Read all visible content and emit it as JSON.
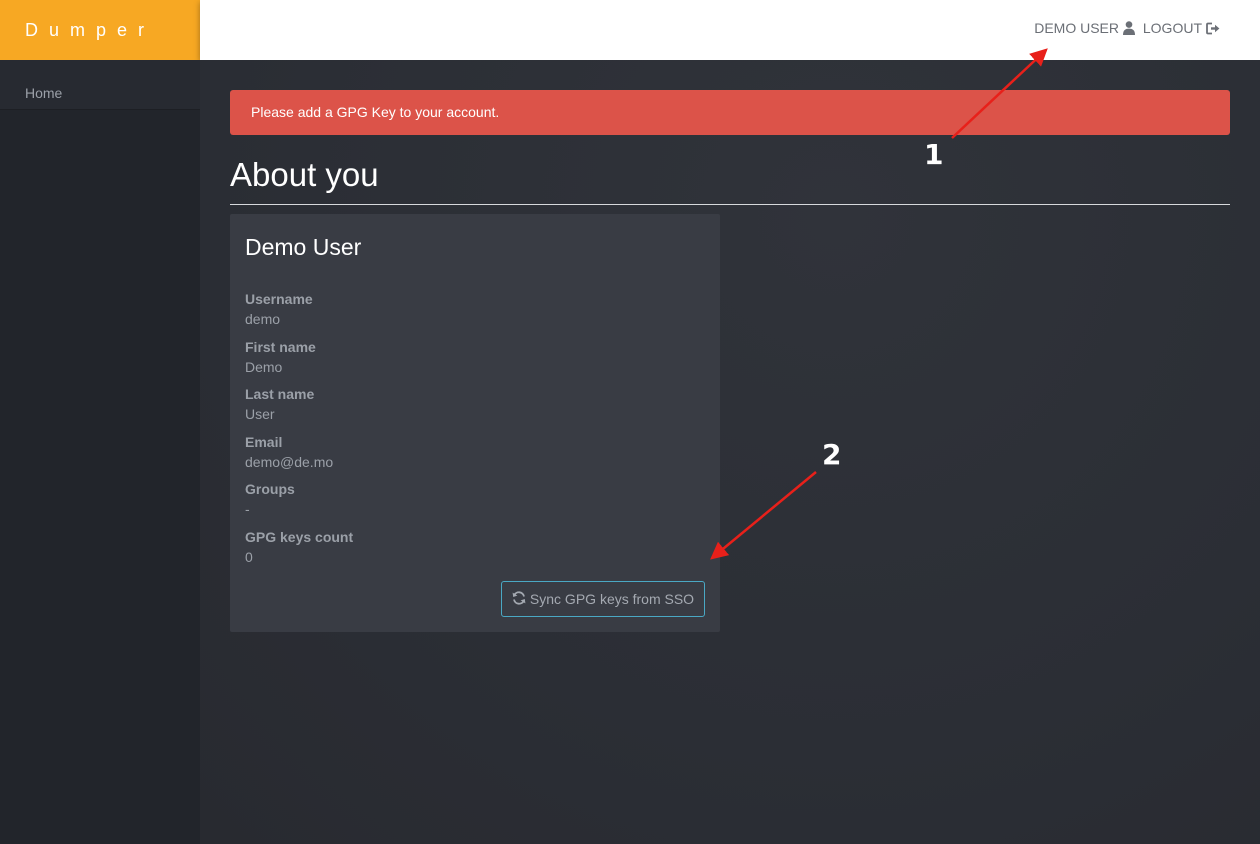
{
  "app": {
    "brand": "Dumper"
  },
  "topbar": {
    "user_label": "DEMO USER",
    "logout_label": "LOGOUT"
  },
  "sidebar": {
    "items": [
      {
        "label": "Home"
      }
    ]
  },
  "alert": {
    "message": "Please add a GPG Key to your account."
  },
  "page": {
    "title": "About you"
  },
  "profile": {
    "name": "Demo User",
    "fields": [
      {
        "label": "Username",
        "value": "demo"
      },
      {
        "label": "First name",
        "value": "Demo"
      },
      {
        "label": "Last name",
        "value": "User"
      },
      {
        "label": "Email",
        "value": "demo@de.mo"
      },
      {
        "label": "Groups",
        "value": "-"
      },
      {
        "label": "GPG keys count",
        "value": "0"
      }
    ],
    "sync_button_label": "Sync GPG keys from SSO"
  },
  "annotations": {
    "marker_1": "1",
    "marker_2": "2",
    "arrow_color": "#e8201a"
  },
  "colors": {
    "brand": "#f7a823",
    "alert": "#dc5349",
    "button_border": "#4aa8c4"
  },
  "icons": {
    "user": "user-icon",
    "logout": "sign-out-icon",
    "sync": "refresh-icon"
  }
}
